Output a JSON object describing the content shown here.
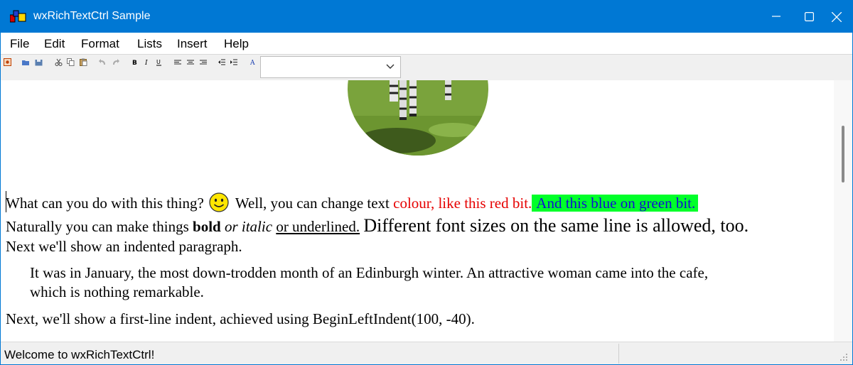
{
  "window": {
    "title": "wxRichTextCtrl Sample",
    "accent_color": "#0078d4"
  },
  "titlebar_controls": [
    "minimize-icon",
    "maximize-icon",
    "close-icon"
  ],
  "menubar": {
    "items": [
      {
        "label": "File"
      },
      {
        "label": "Edit"
      },
      {
        "label": "Format"
      },
      {
        "label": "Lists"
      },
      {
        "label": "Insert"
      },
      {
        "label": "Help"
      }
    ]
  },
  "toolbar": {
    "icons": [
      "about-icon",
      "open-icon",
      "save-icon",
      "cut-icon",
      "copy-icon",
      "paste-icon",
      "undo-icon",
      "redo-icon",
      "bold-icon",
      "italic-icon",
      "underline-icon",
      "align-left-icon",
      "align-center-icon",
      "align-right-icon",
      "indent-less-icon",
      "indent-more-icon",
      "font-icon"
    ],
    "style_combo_value": ""
  },
  "document": {
    "line1": {
      "a": "What can you do with this thing?",
      "b": "Well, you can change text",
      "red": "colour, like this red bit.",
      "bluegreen": "And this blue on green bit."
    },
    "line2": {
      "a": "Naturally you can make things",
      "bold": "bold",
      "italic": "or italic",
      "underlined": "or underlined.",
      "big": "Different font sizes on the same line is allowed, too."
    },
    "line3": "Next we'll show an indented paragraph.",
    "indented": {
      "l1": "It was in January, the most down-trodden month of an Edinburgh winter. An attractive woman came into the cafe,",
      "l2": "which is nothing remarkable."
    },
    "line4": "Next, we'll show a first-line indent, achieved using BeginLeftIndent(100, -40).",
    "colors": {
      "red": "#e60000",
      "blue": "#1010d0",
      "green": "#00ff2a"
    }
  },
  "statusbar": {
    "text": "Welcome to wxRichTextCtrl!"
  }
}
